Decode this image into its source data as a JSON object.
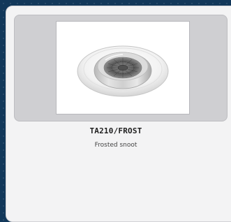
{
  "product": {
    "code": "TA210/FROST",
    "description": "Frosted snoot",
    "image_subject": "recessed-downlight-frosted-snoot"
  },
  "colors": {
    "background": "#12385a",
    "card": "#f3f3f4",
    "image_frame": "#cfcfd2",
    "text_primary": "#1e1e1e",
    "text_secondary": "#444444"
  }
}
